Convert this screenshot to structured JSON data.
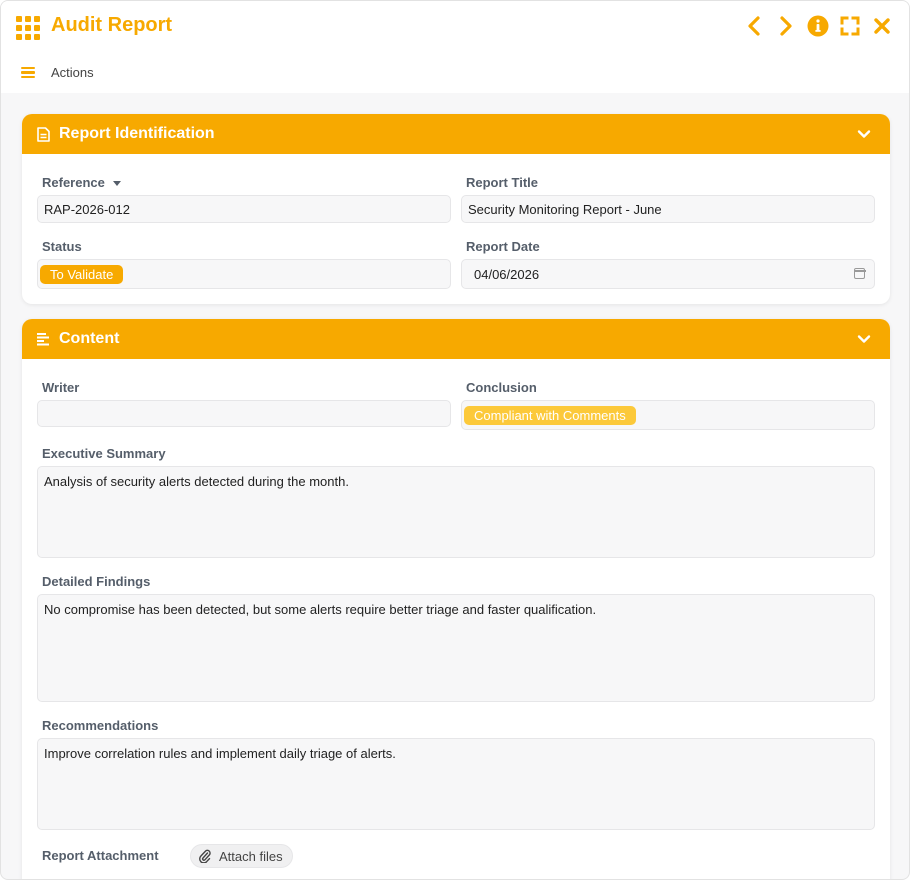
{
  "app": {
    "title": "Audit Report",
    "accent": "#f7a900"
  },
  "toolbar": {
    "actions_label": "Actions"
  },
  "identification": {
    "title": "Report Identification",
    "reference_label": "Reference",
    "reference_value": "RAP-2026-012",
    "report_title_label": "Report Title",
    "report_title_value": "Security Monitoring Report - June",
    "status_label": "Status",
    "status_value": "To Validate",
    "report_date_label": "Report Date",
    "report_date_value": "04/06/2026"
  },
  "content": {
    "title": "Content",
    "writer_label": "Writer",
    "writer_value": "",
    "conclusion_label": "Conclusion",
    "conclusion_value": "Compliant with Comments",
    "summary_label": "Executive Summary",
    "summary_value": "Analysis of security alerts detected during the month.",
    "findings_label": "Detailed Findings",
    "findings_value": "No compromise has been detected, but some alerts require better triage and faster qualification.",
    "recommendations_label": "Recommendations",
    "recommendations_value": "Improve correlation rules and implement daily triage of alerts.",
    "attachment_label": "Report Attachment",
    "attach_button_label": "Attach files"
  },
  "icons": [
    "grid-icon",
    "chevron-left-icon",
    "chevron-right-icon",
    "info-icon",
    "fullscreen-icon",
    "close-icon",
    "hamburger-menu-icon",
    "document-icon",
    "text-align-icon",
    "chevron-down-icon",
    "calendar-icon",
    "paperclip-icon"
  ]
}
